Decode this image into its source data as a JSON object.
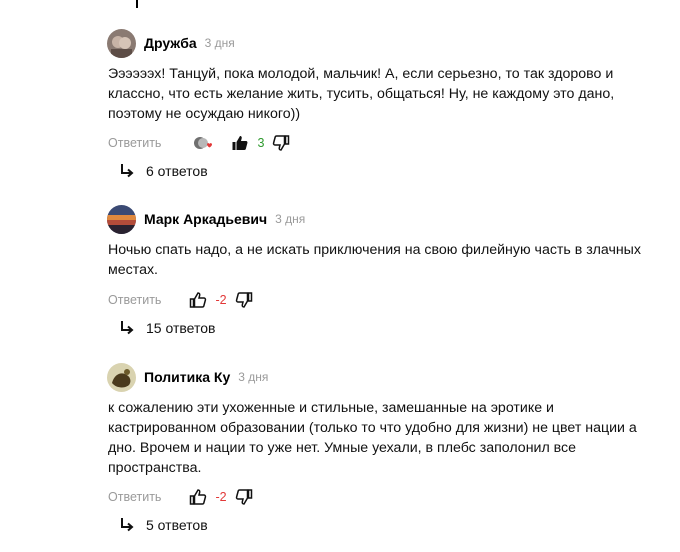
{
  "comments": [
    {
      "author": "Дружба",
      "date": "3 дня",
      "text": "Ээээээх! Танцуй, пока молодой, мальчик! А, если серьезно, то так здорово и классно, что есть желание жить, тусить, общаться! Ну, не каждому это дано, поэтому не осуждаю никого))",
      "reply_label": "Ответить",
      "score": "3",
      "answers_label": "6 ответов"
    },
    {
      "author": "Марк Аркадьевич",
      "date": "3 дня",
      "text": "Ночью спать надо, а не искать приключения на свою филейную часть в злачных местах.",
      "reply_label": "Ответить",
      "score": "-2",
      "answers_label": "15 ответов"
    },
    {
      "author": "Политика Ку",
      "date": "3 дня",
      "text": "к сожалению эти ухоженные и стильные, замешанные на эротике и кастрированном образовании (только то что удобно для жизни) не цвет нации а дно. Врочем и нации то уже нет. Умные уехали, в плебс заполонил все пространства.",
      "reply_label": "Ответить",
      "score": "-2",
      "answers_label": "5 ответов"
    }
  ],
  "colors": {
    "positive": "#2e9a2e",
    "negative": "#e23838",
    "muted": "#9a9a9a"
  },
  "icons": [
    "reactions-icon",
    "thumbs-up-icon",
    "thumbs-down-icon",
    "reply-arrow-icon"
  ]
}
